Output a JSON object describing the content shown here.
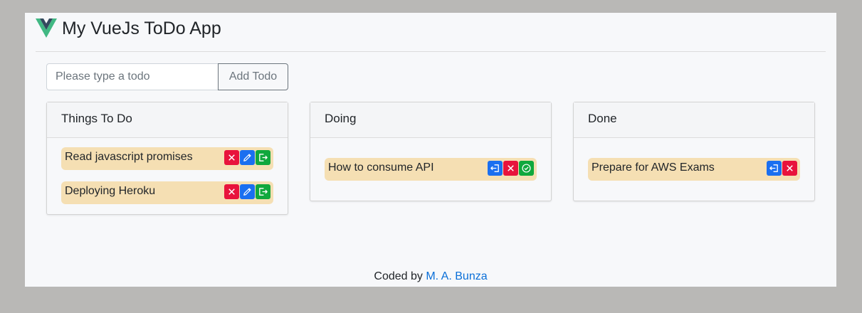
{
  "app": {
    "title": "My VueJs ToDo App",
    "logo_icon": "vue-logo-icon"
  },
  "add_todo": {
    "placeholder": "Please type a todo",
    "value": "",
    "button_label": "Add Todo"
  },
  "columns": [
    {
      "title": "Things To Do",
      "items": [
        {
          "text": "Read javascript promises",
          "actions": [
            "delete-icon",
            "edit-icon",
            "move-right-icon"
          ]
        },
        {
          "text": "Deploying Heroku",
          "actions": [
            "delete-icon",
            "edit-icon",
            "move-right-icon"
          ]
        }
      ]
    },
    {
      "title": "Doing",
      "items": [
        {
          "text": "How to consume API",
          "actions": [
            "move-left-icon",
            "delete-icon",
            "check-icon"
          ]
        }
      ]
    },
    {
      "title": "Done",
      "items": [
        {
          "text": "Prepare for AWS Exams",
          "actions": [
            "move-left-icon",
            "delete-icon"
          ]
        }
      ]
    }
  ],
  "footer": {
    "prefix": "Coded by",
    "author": "M. A. Bunza"
  },
  "colors": {
    "card_bg": "#f5dfb3",
    "delete": "#e8133c",
    "edit": "#1a6ff0",
    "move": "#10a83d",
    "link": "#0a6fd8"
  }
}
